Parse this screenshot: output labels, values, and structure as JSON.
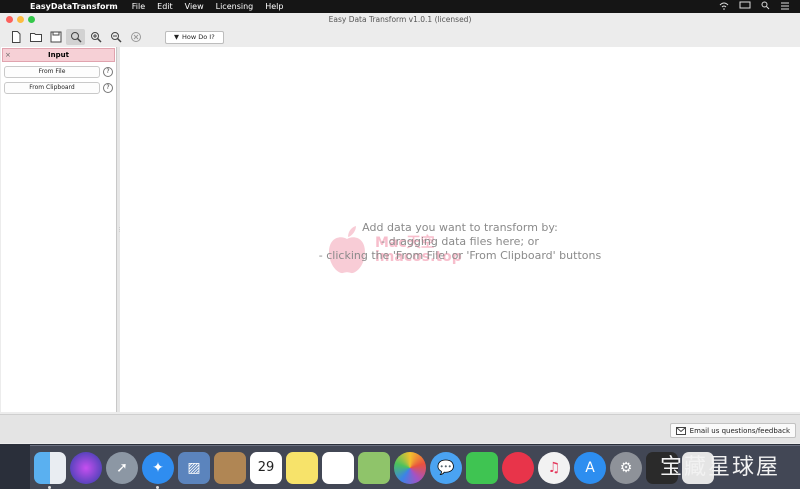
{
  "menubar": {
    "app_name": "EasyDataTransform",
    "items": [
      "File",
      "Edit",
      "View",
      "Licensing",
      "Help"
    ],
    "right_icons": [
      "wifi-icon",
      "airplay-icon",
      "search-icon",
      "menu-icon"
    ]
  },
  "window": {
    "title": "Easy Data Transform v1.0.1 (licensed)"
  },
  "toolbar": {
    "how_do_i_label": "How Do I?",
    "how_do_i_arrow": "▼"
  },
  "left_panel": {
    "header_label": "Input",
    "header_close": "×",
    "from_file_label": "From File",
    "from_clipboard_label": "From Clipboard",
    "help_mark": "?"
  },
  "canvas": {
    "hint_line1": "Add data you want to transform by:",
    "hint_line2": "- dragging data files here; or",
    "hint_line3": "- clicking the 'From File' or 'From Clipboard' buttons"
  },
  "watermark": {
    "line1": "Mac天空",
    "line2": "imacos.top"
  },
  "statusbar": {
    "feedback_label": "Email us questions/feedback"
  },
  "dock": {
    "apps": [
      "finder-icon",
      "siri-icon",
      "launchpad-icon",
      "safari-icon",
      "preview-icon",
      "notefile-icon",
      "calendar-icon",
      "notes-icon",
      "reminders-icon",
      "maps-icon",
      "photos-icon",
      "messages-icon",
      "facetime-icon",
      "news-icon",
      "music-icon",
      "appstore-icon",
      "system-preferences-icon",
      "terminal-icon",
      "activity-icon"
    ],
    "calendar_day": "29",
    "bottom_watermark": "宝藏星球屋"
  }
}
